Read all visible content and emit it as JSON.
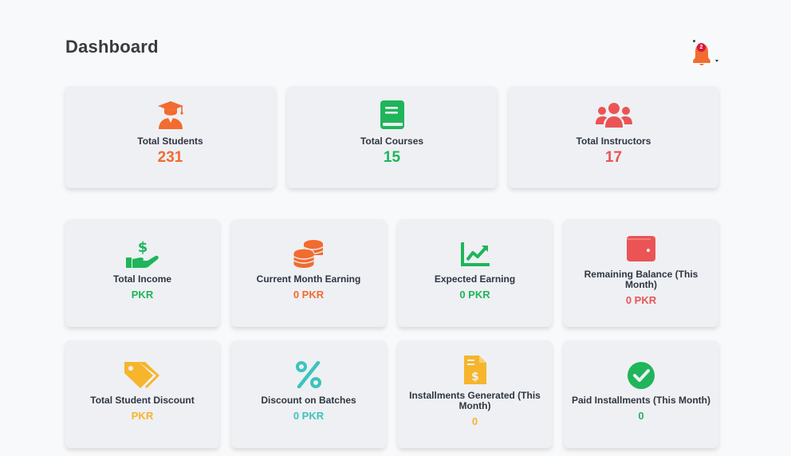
{
  "header": {
    "title": "Dashboard",
    "notification_count": "2"
  },
  "colors": {
    "orange": "#f26b2f",
    "green": "#1fb55a",
    "red": "#ea5455",
    "yellow": "#f6b52b",
    "teal": "#3cc4bc"
  },
  "summary": [
    {
      "label": "Total Students",
      "value": "231",
      "icon": "graduate-icon"
    },
    {
      "label": "Total Courses",
      "value": "15",
      "icon": "book-icon"
    },
    {
      "label": "Total Instructors",
      "value": "17",
      "icon": "users-icon"
    }
  ],
  "stats_row1": [
    {
      "label": "Total Income",
      "value": "PKR",
      "icon": "hand-dollar-icon"
    },
    {
      "label": "Current Month Earning",
      "value": "0 PKR",
      "icon": "coins-icon"
    },
    {
      "label": "Expected Earning",
      "value": "0 PKR",
      "icon": "chart-trend-icon"
    },
    {
      "label": "Remaining Balance (This Month)",
      "value": "0 PKR",
      "icon": "wallet-icon"
    }
  ],
  "stats_row2": [
    {
      "label": "Total Student Discount",
      "value": "PKR",
      "icon": "tags-icon"
    },
    {
      "label": "Discount on Batches",
      "value": "0 PKR",
      "icon": "percent-icon"
    },
    {
      "label": "Installments Generated (This Month)",
      "value": "0",
      "icon": "invoice-dollar-icon"
    },
    {
      "label": "Paid Installments (This Month)",
      "value": "0",
      "icon": "check-circle-icon"
    }
  ]
}
